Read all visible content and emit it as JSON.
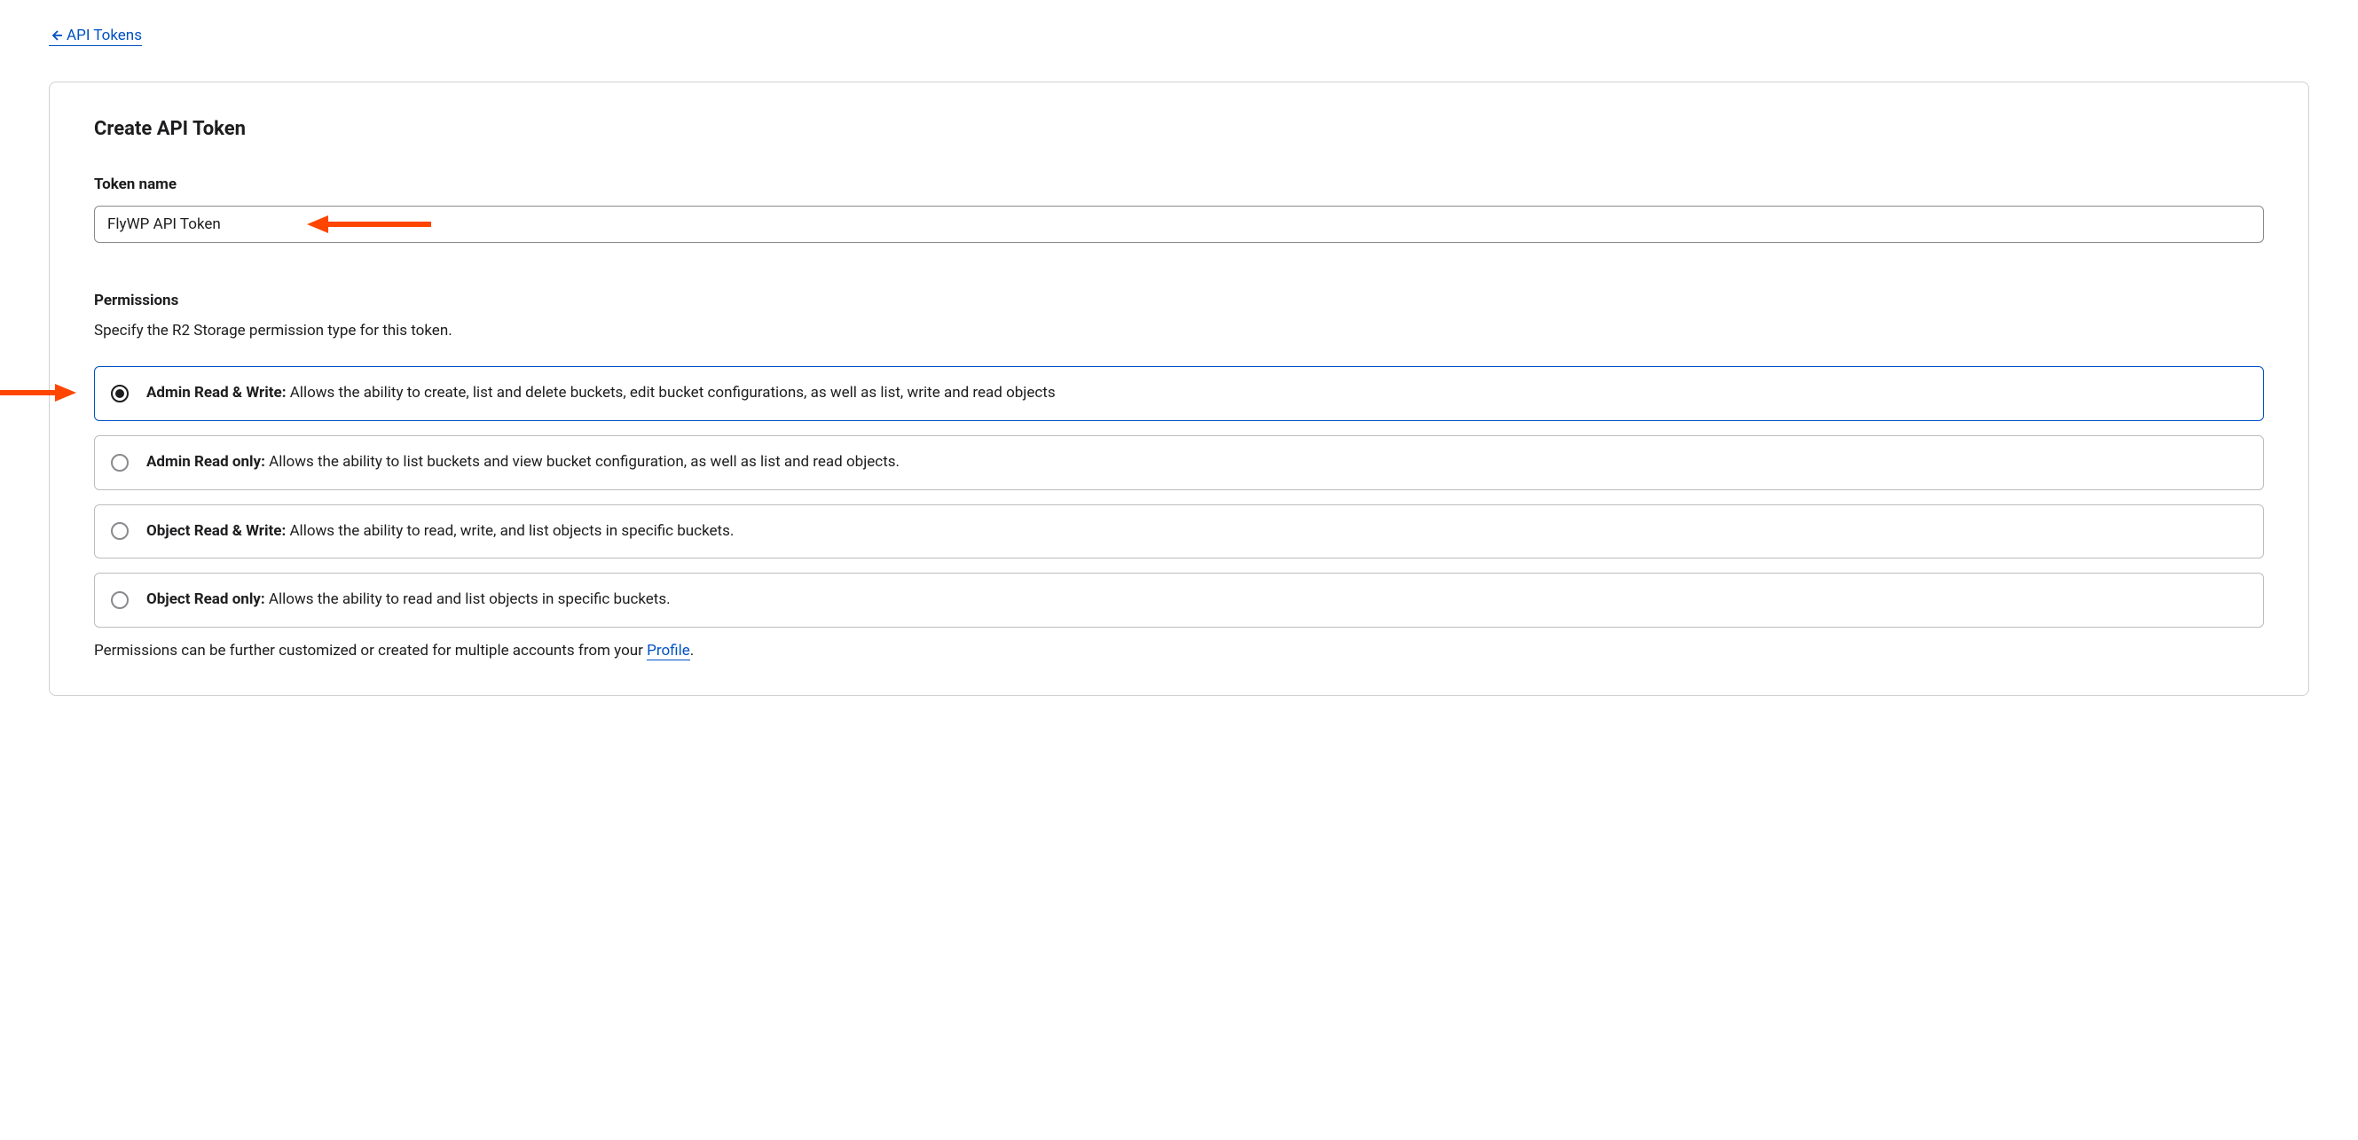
{
  "breadcrumb": {
    "back_label": "API Tokens"
  },
  "page": {
    "title": "Create API Token"
  },
  "form": {
    "token_name_label": "Token name",
    "token_name_value": "FlyWP API Token",
    "permissions_label": "Permissions",
    "permissions_subtext": "Specify the R2 Storage permission type for this token.",
    "permissions_options": [
      {
        "title": "Admin Read & Write:",
        "description": " Allows the ability to create, list and delete buckets, edit bucket configurations, as well as list, write and read objects",
        "selected": true
      },
      {
        "title": "Admin Read only:",
        "description": " Allows the ability to list buckets and view bucket configuration, as well as list and read objects.",
        "selected": false
      },
      {
        "title": "Object Read & Write:",
        "description": " Allows the ability to read, write, and list objects in specific buckets.",
        "selected": false
      },
      {
        "title": "Object Read only:",
        "description": " Allows the ability to read and list objects in specific buckets.",
        "selected": false
      }
    ],
    "footer_note_prefix": "Permissions can be further customized or created for multiple accounts from your ",
    "footer_note_link": "Profile",
    "footer_note_suffix": "."
  },
  "annotations": {
    "arrow_color": "#ff4500"
  }
}
